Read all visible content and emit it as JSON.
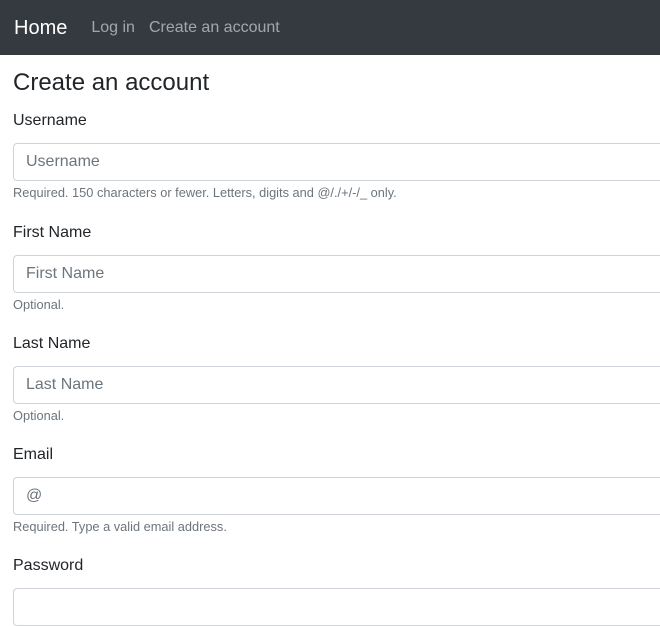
{
  "nav": {
    "brand": "Home",
    "links": [
      "Log in",
      "Create an account"
    ]
  },
  "page": {
    "title": "Create an account"
  },
  "form": {
    "fields": [
      {
        "label": "Username",
        "placeholder": "Username",
        "help": "Required. 150 characters or fewer. Letters, digits and @/./+/-/_ only."
      },
      {
        "label": "First Name",
        "placeholder": "First Name",
        "help": "Optional."
      },
      {
        "label": "Last Name",
        "placeholder": "Last Name",
        "help": "Optional."
      },
      {
        "label": "Email",
        "placeholder": "@",
        "help": "Required. Type a valid email address."
      },
      {
        "label": "Password",
        "placeholder": "",
        "help": ""
      }
    ]
  }
}
